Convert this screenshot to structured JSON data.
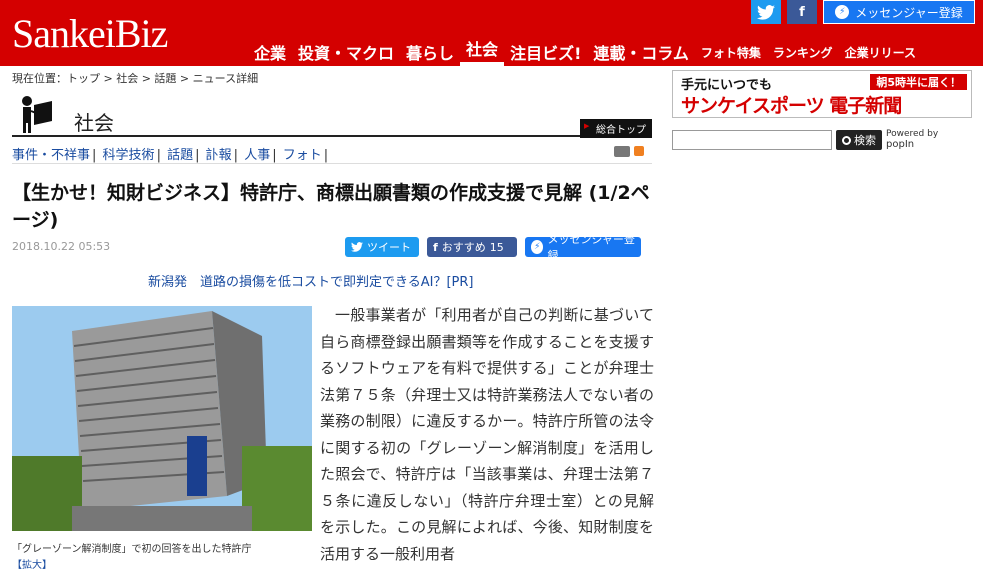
{
  "header": {
    "logo_sankei": "Sankei",
    "logo_biz": "Biz",
    "social": {
      "twitter": "t",
      "facebook": "f",
      "messenger": "メッセンジャー登録"
    },
    "nav": [
      "企業",
      "投資・マクロ",
      "暮らし",
      "社会",
      "注目ビズ!",
      "連載・コラム",
      "フォト特集",
      "ランキング",
      "企業リリース"
    ]
  },
  "breadcrumb": "現在位置：トップ > 社会 > 話題 > ニュース詳細",
  "section": {
    "title": "社会",
    "top_button": "総合トップ"
  },
  "subnav": [
    "事件・不祥事",
    "科学技術",
    "話題",
    "訃報",
    "人事",
    "フォト"
  ],
  "article": {
    "title": "【生かせ！知財ビジネス】特許庁、商標出願書類の作成支援で見解 (1/2ページ)",
    "date": "2018.10.22 05:53",
    "share": {
      "tweet": "ツイート",
      "recommend": "おすすめ",
      "recommend_count": "15",
      "messenger": "メッセンジャー登録"
    },
    "pr_link": "新潟発　道路の損傷を低コストで即判定できるAI？[PR]",
    "photo_caption": "「グレーゾーン解消制度」で初の回答を出した特許庁",
    "enlarge": "【拡大】",
    "body": "一般事業者が「利用者が自己の判断に基づいて自ら商標登録出願書類等を作成することを支援するソフトウェアを有料で提供する」ことが弁理士法第７５条（弁理士又は特許業務法人でない者の業務の制限）に違反するかー。特許庁所管の法令に関する初の「グレーゾーン解消制度」を活用した照会で、特許庁は「当該事業は、弁理士法第７５条に違反しない」（特許庁弁理士室）との見解を示した。この見解によれば、今後、知財制度を活用する一般利用者"
  },
  "sidebar": {
    "ad": {
      "top": "手元にいつでも",
      "badge": "朝5時半に届く！",
      "main": "サンケイスポーツ 電子新聞"
    },
    "search": {
      "button": "検索",
      "powered": "Powered by",
      "brand": "popIn"
    }
  }
}
